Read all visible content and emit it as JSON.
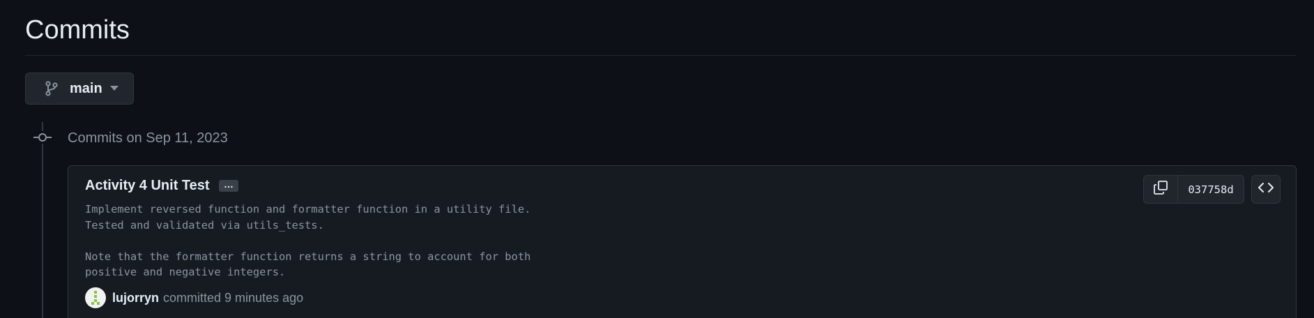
{
  "page": {
    "title": "Commits"
  },
  "branch_selector": {
    "label": "main",
    "icon": "git-branch-icon",
    "caret_icon": "triangle-down-icon"
  },
  "commit_groups": [
    {
      "heading": "Commits on Sep 11, 2023",
      "commits": [
        {
          "title": "Activity 4 Unit Test",
          "ellipsis_label": "…",
          "message_lines": [
            "Implement reversed function and formatter function in a utility file.",
            "Tested and validated via utils_tests.",
            "",
            "Note that the formatter function returns a string to account for both",
            "positive and negative integers."
          ],
          "author": "lujorryn",
          "action_text": "committed 9 minutes ago",
          "sha": "037758d",
          "copy_icon": "copy-icon",
          "browse_icon": "code-icon"
        }
      ]
    }
  ],
  "colors": {
    "background": "#0d1117",
    "card_background": "#161b22",
    "border": "#30363d",
    "text_primary": "#e6edf3",
    "text_muted": "#8b949e",
    "avatar_accent": "#8bc34a"
  }
}
